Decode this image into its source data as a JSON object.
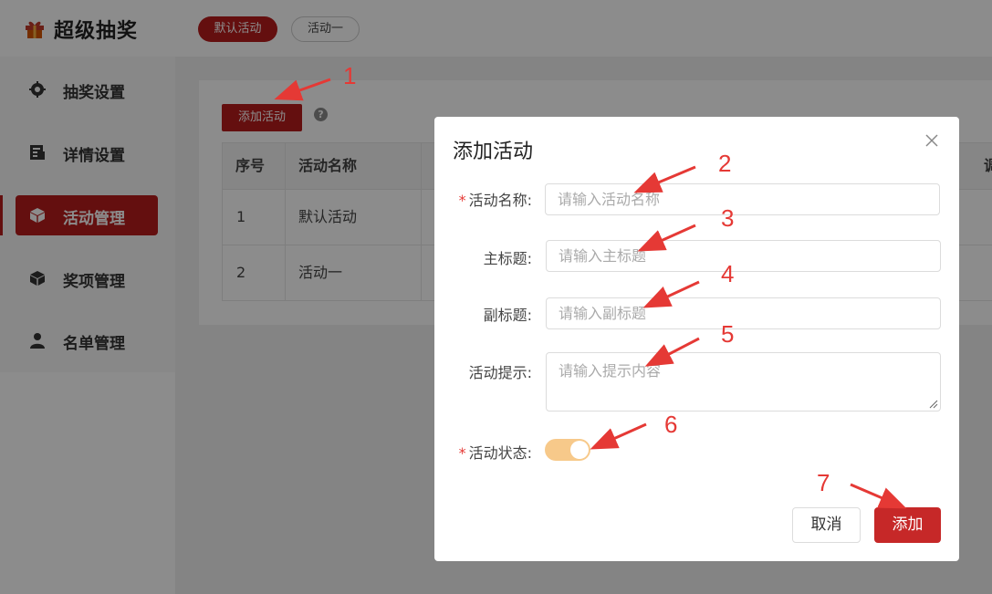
{
  "header": {
    "app_title": "超级抽奖",
    "tabs": [
      {
        "label": "默认活动",
        "active": true
      },
      {
        "label": "活动一",
        "active": false
      }
    ]
  },
  "sidebar": {
    "items": [
      {
        "label": "抽奖设置",
        "icon": "gear-icon",
        "active": false
      },
      {
        "label": "详情设置",
        "icon": "document-icon",
        "active": false
      },
      {
        "label": "活动管理",
        "icon": "cube-icon",
        "active": true
      },
      {
        "label": "奖项管理",
        "icon": "cube-icon",
        "active": false
      },
      {
        "label": "名单管理",
        "icon": "user-icon",
        "active": false
      }
    ]
  },
  "main": {
    "add_button_label": "添加活动",
    "help_icon": "?",
    "table": {
      "headers": [
        "序号",
        "活动名称",
        "调"
      ],
      "rows": [
        [
          "1",
          "默认活动"
        ],
        [
          "2",
          "活动一"
        ]
      ]
    }
  },
  "dialog": {
    "title": "添加活动",
    "fields": {
      "name": {
        "label": "活动名称:",
        "placeholder": "请输入活动名称",
        "required": true
      },
      "main_title": {
        "label": "主标题:",
        "placeholder": "请输入主标题"
      },
      "subtitle": {
        "label": "副标题:",
        "placeholder": "请输入副标题"
      },
      "tip": {
        "label": "活动提示:",
        "placeholder": "请输入提示内容"
      },
      "status": {
        "label": "活动状态:",
        "required": true,
        "on": true
      }
    },
    "cancel_label": "取消",
    "submit_label": "添加"
  },
  "annotations": [
    "1",
    "2",
    "3",
    "4",
    "5",
    "6",
    "7"
  ],
  "colors": {
    "brand": "#b71c1c",
    "annotation": "#e53935",
    "switch_on": "#f7c98a"
  }
}
